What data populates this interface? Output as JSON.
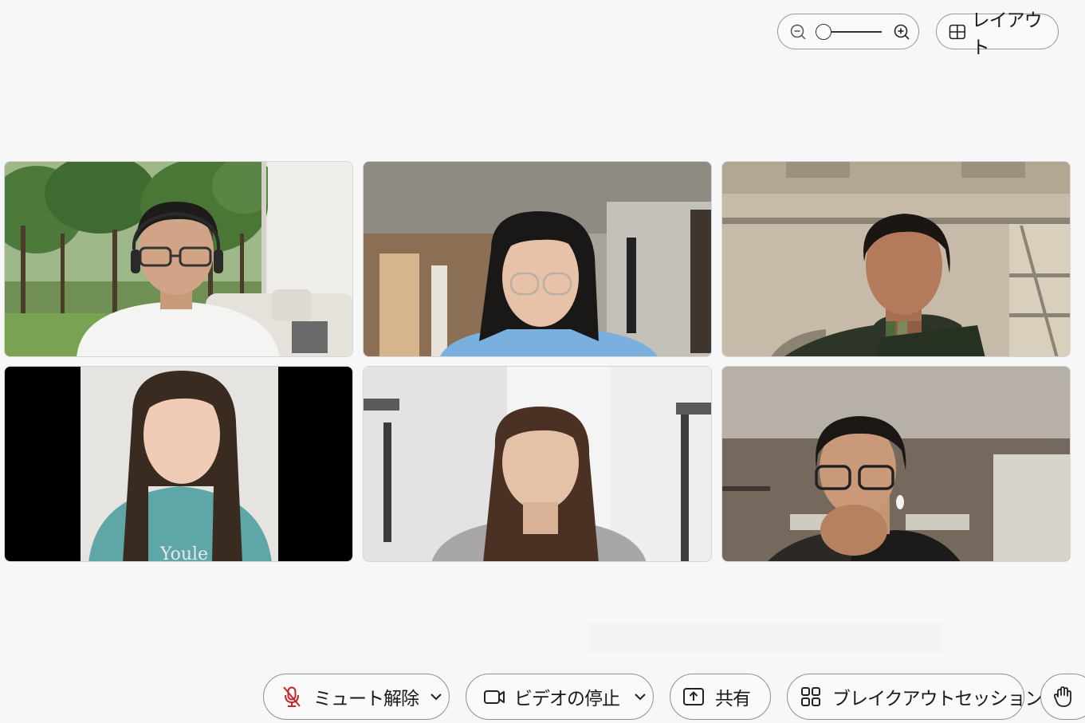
{
  "top_bar": {
    "zoom": {
      "level": 0.0
    },
    "layout_label": "レイアウト"
  },
  "participants": [
    {
      "position": "top-left",
      "scene": "park-background"
    },
    {
      "position": "top-center",
      "scene": "bedroom"
    },
    {
      "position": "top-right",
      "scene": "office-ceiling"
    },
    {
      "position": "bottom-left",
      "scene": "white-wall-letterbox"
    },
    {
      "position": "bottom-center",
      "scene": "white-room"
    },
    {
      "position": "bottom-right",
      "scene": "office"
    }
  ],
  "toolbar": {
    "unmute_label": "ミュート解除",
    "video_label": "ビデオの停止",
    "share_label": "共有",
    "breakout_label": "ブレイクアウトセッション"
  },
  "icons": {
    "mic_muted": "mic-muted-icon",
    "camera": "camera-icon",
    "share": "share-icon",
    "breakout": "breakout-grid-icon",
    "raise_hand": "raise-hand-icon",
    "layout": "layout-grid-icon",
    "zoom_in": "zoom-in-icon",
    "zoom_out": "zoom-out-icon"
  },
  "colors": {
    "muted_red": "#c4262e",
    "background": "#f7f7f7"
  }
}
